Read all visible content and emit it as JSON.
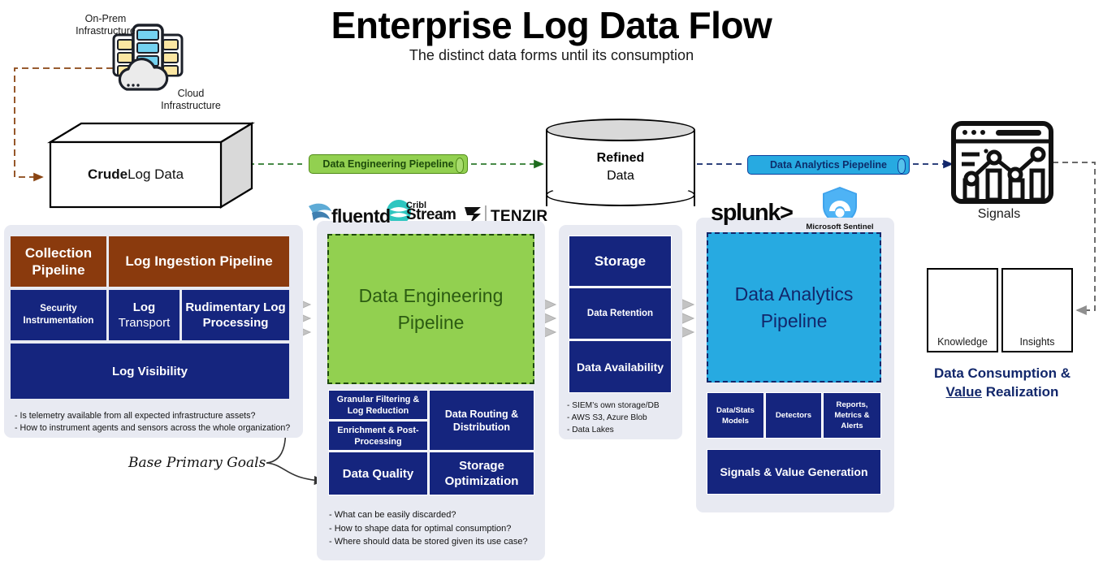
{
  "header": {
    "title": "Enterprise Log Data Flow",
    "subtitle": "The distinct data forms until its consumption"
  },
  "sources": {
    "onprem_label": "On-Prem\nInfrastructure",
    "onprem_line1": "On-Prem",
    "onprem_line2": "Infrastructure",
    "cloud_line1": "Cloud",
    "cloud_line2": "Infrastructure",
    "onprem_icon": "server-rack-icon",
    "cloud_icon": "cloud-icon"
  },
  "flow": {
    "crude_bold": "Crude",
    "crude_rest": " Log Data",
    "pipe_engineering": "Data Engineering Piepeline",
    "pipe_analytics": "Data Analytics Piepeline",
    "refined_bold": "Refined",
    "refined_rest": "Data",
    "signals_label": "Signals",
    "signals_icon": "chart-dashboard-icon"
  },
  "collection_panel": {
    "collection_pipeline": "Collection Pipeline",
    "log_ingestion_pipeline": "Log Ingestion Pipeline",
    "security_instrumentation": "Security Instrumentation",
    "log_transport_bold": "Log",
    "log_transport_rest": "Transport",
    "rudimentary_log_processing": "Rudimentary Log Processing",
    "log_visibility": "Log Visibility",
    "note1": "- Is telemetry available from all expected infrastructure assets?",
    "note2": "- How to instrument agents and sensors across the whole organization?"
  },
  "engineering_panel": {
    "vendors": [
      "fluentd",
      "Cribl Stream",
      "TENZIR"
    ],
    "vendor_fluentd": "fluentd",
    "vendor_cribl_small": "Cribl",
    "vendor_cribl_big": "Stream",
    "vendor_tenzir": "TENZIR",
    "main_title": "Data Engineering Pipeline",
    "granular_filtering": "Granular Filtering & Log Reduction",
    "enrichment": "Enrichment & Post-Processing",
    "data_routing": "Data Routing & Distribution",
    "data_quality": "Data Quality",
    "storage_optimization": "Storage Optimization",
    "note1": "- What can be easily discarded?",
    "note2": "- How to shape data for optimal consumption?",
    "note3": "- Where should data be stored given its use case?"
  },
  "storage_panel": {
    "storage": "Storage",
    "data_retention": "Data Retention",
    "data_availability": "Data Availability",
    "note1": "- SIEM’s own storage/DB",
    "note2": "- AWS S3, Azure Blob",
    "note3": "- Data Lakes"
  },
  "analytics_panel": {
    "vendor_splunk": "splunk>",
    "vendor_sentinel": "Microsoft Sentinel",
    "sentinel_icon": "shield-sentinel-icon",
    "main_title": "Data Analytics Pipeline",
    "data_stats_models": "Data/Stats Models",
    "detectors": "Detectors",
    "reports_metrics_alerts": "Reports, Metrics & Alerts",
    "signals_value_generation": "Signals & Value Generation"
  },
  "consumption": {
    "knowledge_label": "Knowledge",
    "knowledge_icon": "lightbulb-gear-icon",
    "insights_label": "Insights",
    "insights_icon": "people-arrows-icon",
    "title_line1": "Data Consumption &",
    "title_line2_underlined": "Value",
    "title_line2_rest": " Realization"
  },
  "annotations": {
    "base_primary_goals": "Base Primary Goals"
  },
  "colors": {
    "navy": "#15257e",
    "brown": "#8a3a0d",
    "green": "#92d050",
    "blue": "#27aae1",
    "panel_bg": "#e8eaf2",
    "arrow_gray": "#bdbdbd",
    "brown_arrow": "#8a4513"
  }
}
